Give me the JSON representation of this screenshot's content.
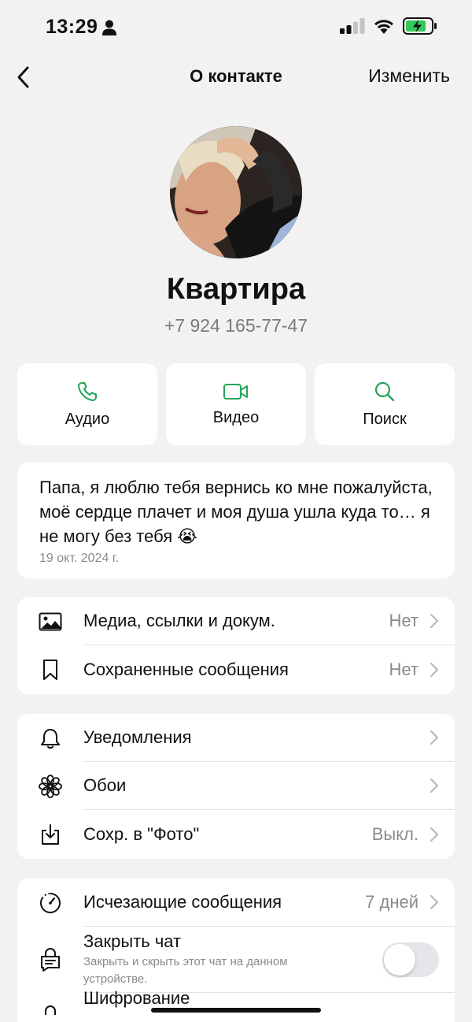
{
  "status": {
    "time": "13:29"
  },
  "nav": {
    "back_icon": "chevron-left-icon",
    "title": "О контакте",
    "edit": "Изменить"
  },
  "contact": {
    "name": "Квартира",
    "phone": "+7 924 165-77-47"
  },
  "actions": [
    {
      "label": "Аудио",
      "icon": "phone-icon"
    },
    {
      "label": "Видео",
      "icon": "video-icon"
    },
    {
      "label": "Поиск",
      "icon": "search-icon"
    }
  ],
  "about": {
    "text": "Папа, я люблю тебя вернись ко мне пожалуйста,  моё сердце плачет и моя душа ушла куда то… я не могу без тебя 😭",
    "date": "19 окт. 2024 г."
  },
  "media_section": [
    {
      "label": "Медиа, ссылки и докум.",
      "value": "Нет",
      "icon": "image-icon"
    },
    {
      "label": "Сохраненные сообщения",
      "value": "Нет",
      "icon": "bookmark-icon"
    }
  ],
  "settings_section": [
    {
      "label": "Уведомления",
      "value": "",
      "icon": "bell-icon"
    },
    {
      "label": "Обои",
      "value": "",
      "icon": "flower-icon"
    },
    {
      "label": "Сохр. в \"Фото\"",
      "value": "Выкл.",
      "icon": "download-icon"
    }
  ],
  "privacy_section": {
    "disappearing": {
      "label": "Исчезающие сообщения",
      "value": "7 дней",
      "icon": "timer-icon"
    },
    "lock_chat": {
      "label": "Закрыть чат",
      "sublabel": "Закрыть и скрыть этот чат на данном устройстве.",
      "icon": "lock-chat-icon",
      "enabled": false
    },
    "encryption": {
      "label": "Шифрование",
      "icon": "lock-icon"
    }
  },
  "colors": {
    "accent": "#25a35a",
    "background": "#f2f2f2",
    "card": "#ffffff",
    "secondary_text": "#8a8a8a"
  }
}
